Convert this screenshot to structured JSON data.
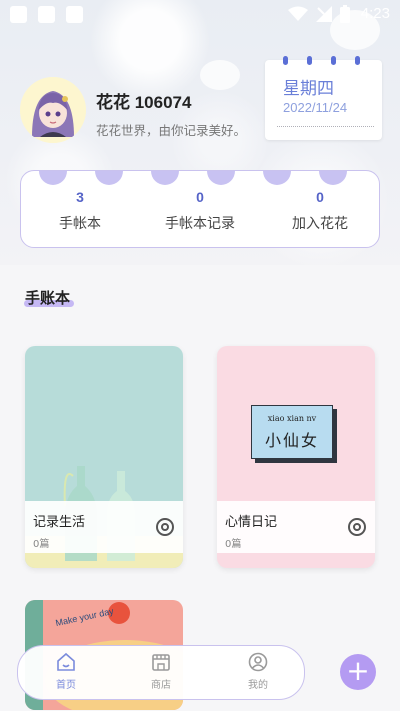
{
  "status_bar": {
    "time": "4:23"
  },
  "profile": {
    "username": "花花 106074",
    "motto": "花花世界，由你记录美好。"
  },
  "calendar": {
    "weekday": "星期四",
    "date": "2022/11/24"
  },
  "stats": [
    {
      "value": "3",
      "label": "手帐本"
    },
    {
      "value": "0",
      "label": "手帐本记录"
    },
    {
      "value": "0",
      "label": "加入花花"
    }
  ],
  "section": {
    "title": "手账本"
  },
  "notebooks": [
    {
      "name": "记录生活",
      "count": "0篇",
      "cover_color": "#b7dcd9"
    },
    {
      "name": "心情日记",
      "count": "0篇",
      "cover_color": "#fadbe3",
      "cover_text_pinyin": "xiao  xian  nv",
      "cover_text": "小仙女"
    },
    {
      "cover_text": "Make your day"
    }
  ],
  "bottom_nav": [
    {
      "label": "首页",
      "icon": "home-icon",
      "active": true
    },
    {
      "label": "商店",
      "icon": "shop-icon",
      "active": false
    },
    {
      "label": "我的",
      "icon": "profile-icon",
      "active": false
    }
  ],
  "fab": {
    "icon": "plus-icon",
    "glyph": "+"
  },
  "colors": {
    "accent": "#7b8bdc",
    "lavender": "#c8c2f2",
    "fab": "#b49bf2"
  }
}
